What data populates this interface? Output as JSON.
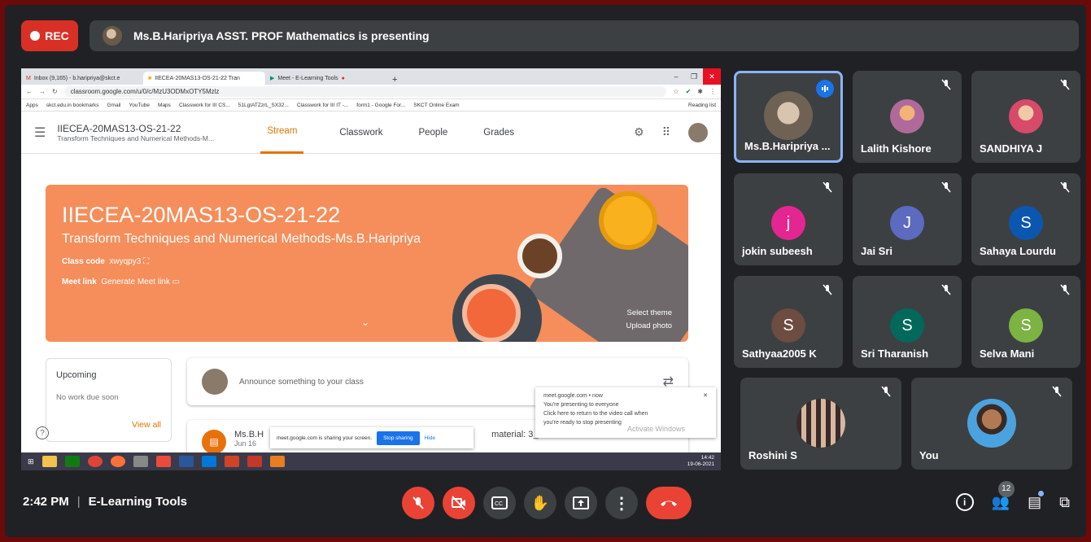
{
  "rec": {
    "label": "REC"
  },
  "presenting": {
    "text": "Ms.B.Haripriya ASST. PROF Mathematics is presenting"
  },
  "browser": {
    "tabs": [
      "Inbox (9,165) - b.haripriya@skct.e",
      "IIECEA-20MAS13-OS-21-22 Tran",
      "Meet - E-Learning Tools"
    ],
    "url": "classroom.google.com/u/0/c/MzU3ODMxOTY5Mzlz",
    "bookmarks": [
      "Apps",
      "skct.edu.in bookmarks",
      "Gmail",
      "YouTube",
      "Maps",
      "Classwork for III CS...",
      "51LgIATZzrL_SX32...",
      "Classwork for III IT -...",
      "form1 - Google For...",
      "SKCT Online Exam",
      "Reading list"
    ]
  },
  "classroom": {
    "class_title": "IIECEA-20MAS13-OS-21-22",
    "class_subtitle": "Transform Techniques and Numerical Methods-M...",
    "tabs": [
      "Stream",
      "Classwork",
      "People",
      "Grades"
    ],
    "banner_title": "IIECEA-20MAS13-OS-21-22",
    "banner_subtitle": "Transform Techniques and Numerical Methods-Ms.B.Haripriya",
    "class_code_label": "Class code",
    "class_code": "xwyqpy3",
    "meet_link_label": "Meet link",
    "meet_link_value": "Generate Meet link",
    "select_theme": "Select theme",
    "upload_photo": "Upload photo",
    "upcoming_title": "Upcoming",
    "upcoming_empty": "No work due soon",
    "view_all": "View all",
    "announce_placeholder": "Announce something to your class",
    "post_author": "Ms.B.H",
    "post_date": "Jun 16",
    "post_text": "material: 3_Z"
  },
  "notification": {
    "source": "meet.google.com",
    "when": "now",
    "line1": "You're presenting to everyone",
    "line2": "Click here to return to the video call when",
    "line3": "you're ready to stop presenting"
  },
  "sharebar": {
    "text": "meet.google.com is sharing your screen.",
    "stop": "Stop sharing",
    "hide": "Hide"
  },
  "taskbar": {
    "time": "14:42",
    "date": "19-06-2021"
  },
  "watermark": "Activate Windows",
  "participants": [
    {
      "name": "Ms.B.Haripriya ...",
      "type": "photo",
      "active": true,
      "photo": "#8a7a6a"
    },
    {
      "name": "Lalith Kishore",
      "type": "photo",
      "photo": "#b06a9a"
    },
    {
      "name": "SANDHIYA J",
      "type": "photo",
      "photo": "#d84a6a"
    },
    {
      "name": "jokin subeesh",
      "type": "initial",
      "initial": "j",
      "color": "#e52592"
    },
    {
      "name": "Jai Sri",
      "type": "initial",
      "initial": "J",
      "color": "#5c6bc0"
    },
    {
      "name": "Sahaya Lourdu",
      "type": "initial",
      "initial": "S",
      "color": "#0b57b0"
    },
    {
      "name": "Sathyaa2005 K",
      "type": "initial",
      "initial": "S",
      "color": "#6d4c41"
    },
    {
      "name": "Sri Tharanish",
      "type": "initial",
      "initial": "S",
      "color": "#00695c"
    },
    {
      "name": "Selva Mani",
      "type": "initial",
      "initial": "S",
      "color": "#7cb342"
    },
    {
      "name": "Roshini S",
      "type": "photo",
      "photo": "#c9a08a"
    },
    {
      "name": "You",
      "type": "photo",
      "photo": "#4aa3df"
    }
  ],
  "bottom": {
    "time": "2:42 PM",
    "separator": "|",
    "meeting": "E-Learning Tools",
    "people_count": "12"
  }
}
